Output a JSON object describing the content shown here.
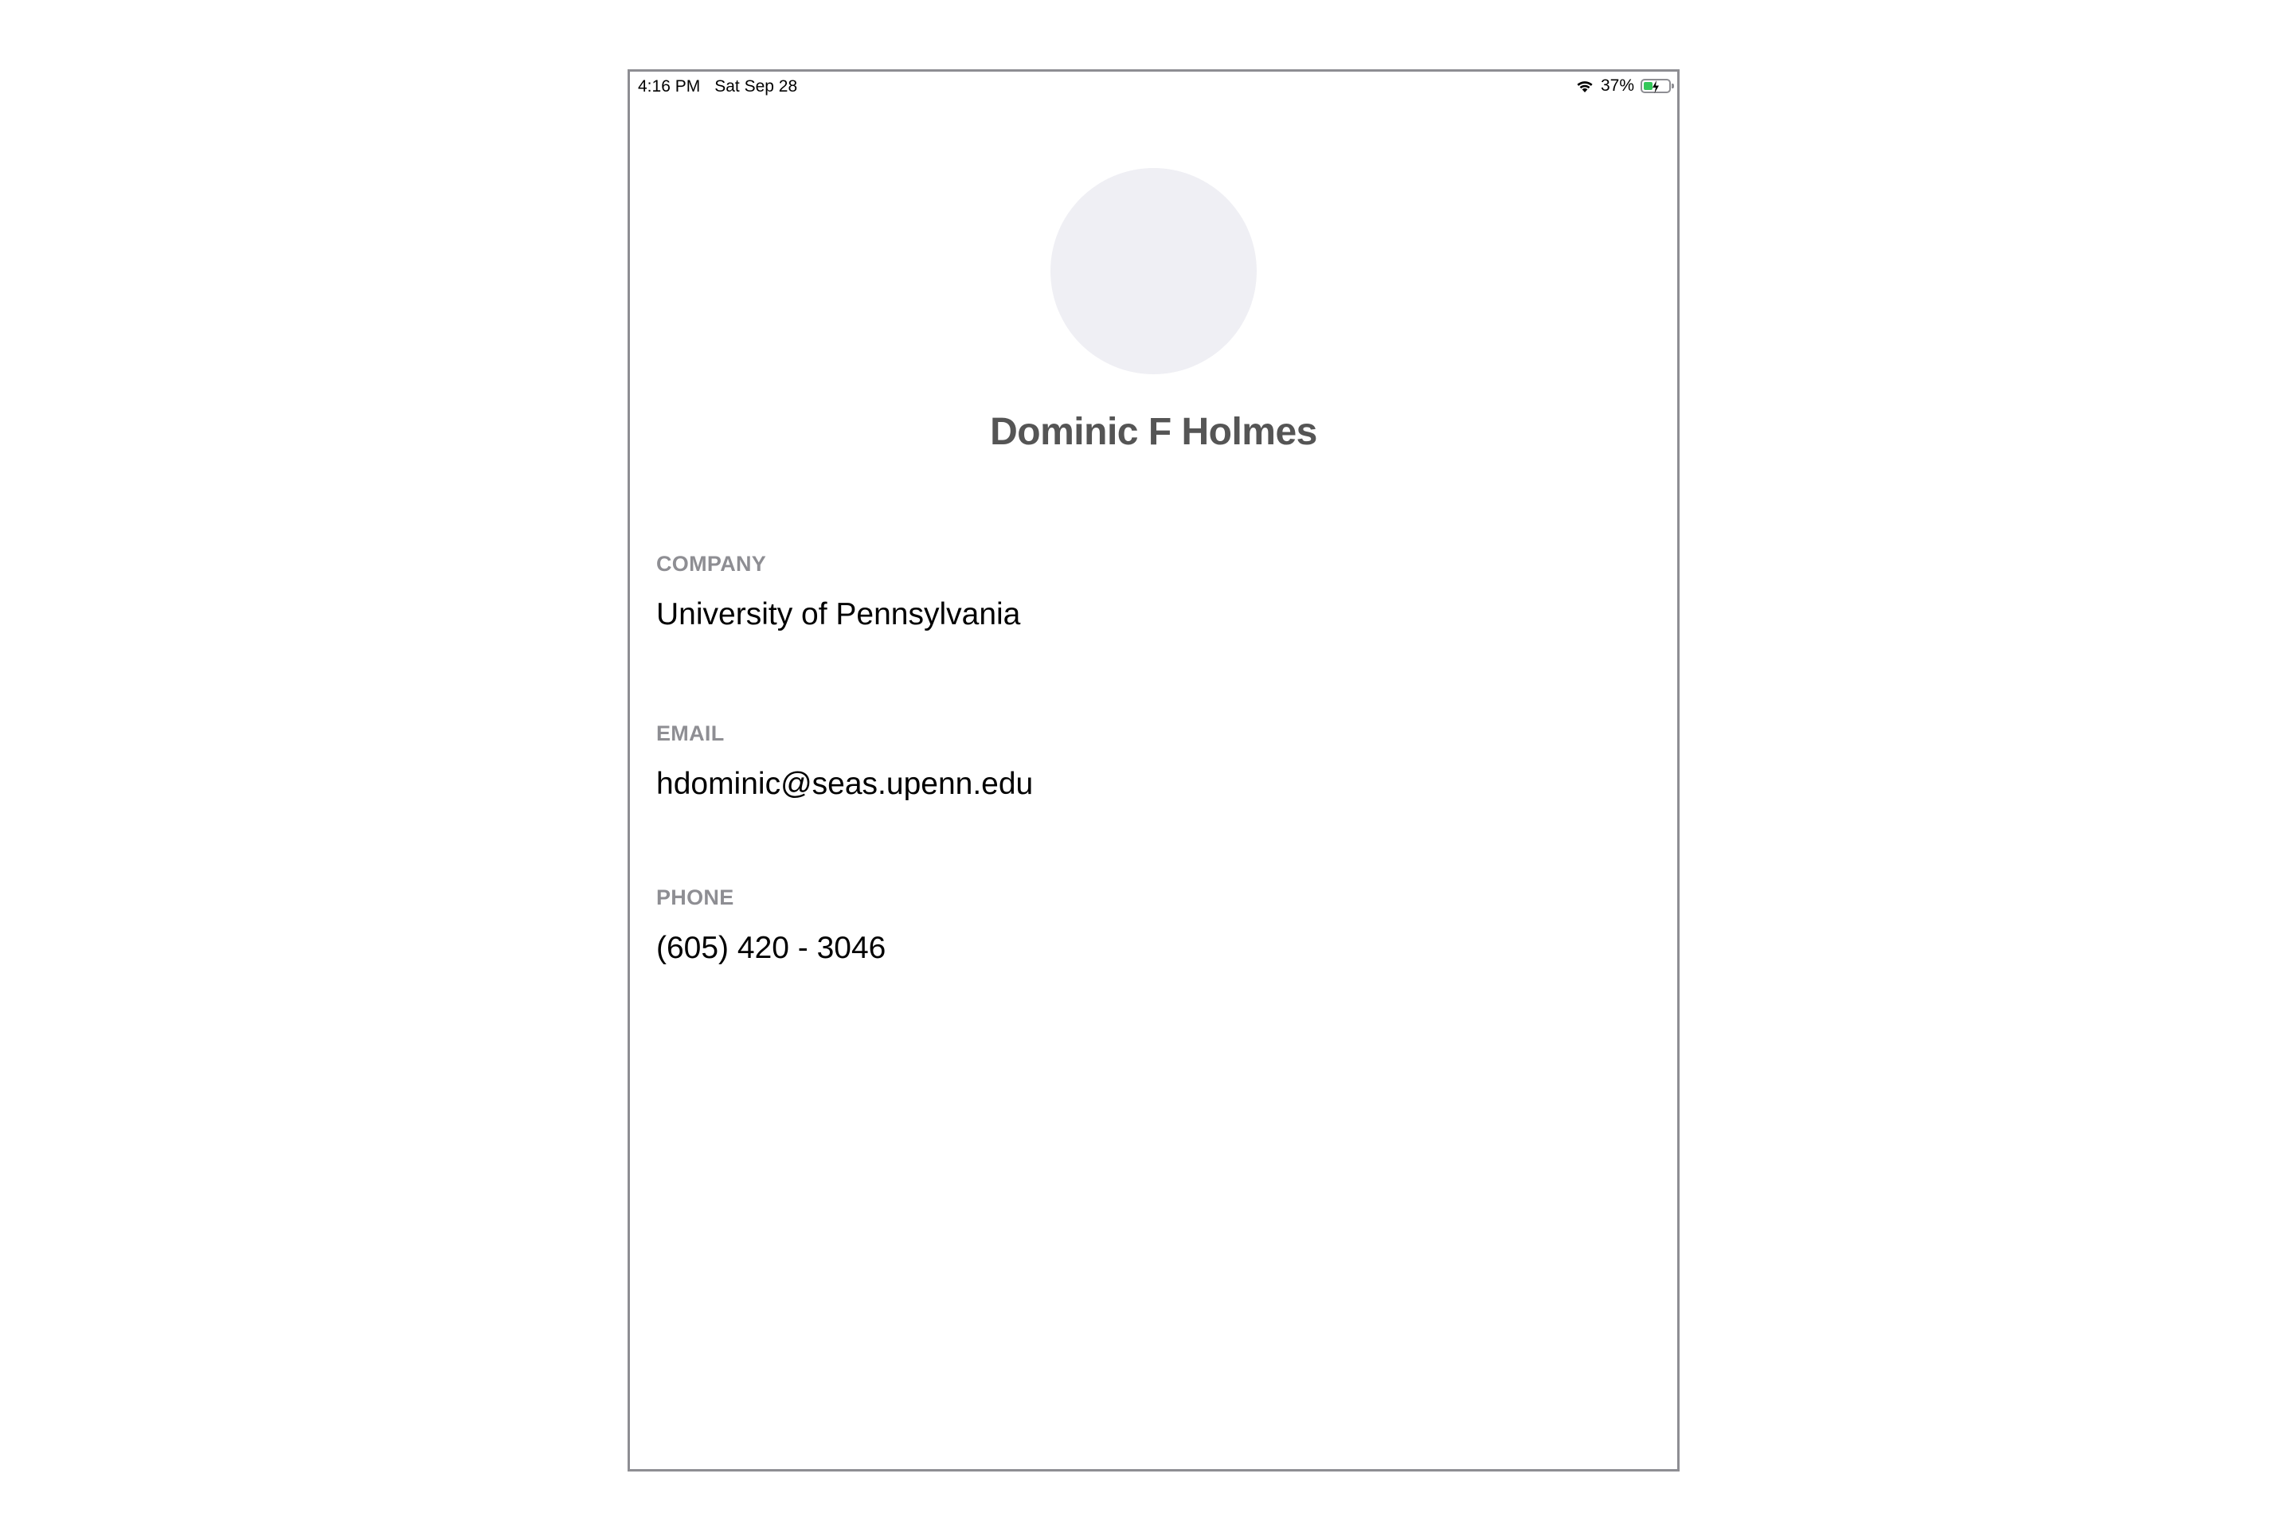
{
  "status_bar": {
    "time": "4:16 PM",
    "date": "Sat Sep 28",
    "battery_percent": "37%",
    "battery_level": 0.37,
    "battery_color": "#34c759",
    "wifi_icon": "wifi-icon",
    "battery_icon": "battery-charging-icon"
  },
  "profile": {
    "avatar_color": "#efeff4",
    "name": "Dominic F Holmes"
  },
  "fields": {
    "company": {
      "label": "COMPANY",
      "value": "University of Pennsylvania"
    },
    "email": {
      "label": "EMAIL",
      "value": "hdominic@seas.upenn.edu"
    },
    "phone": {
      "label": "PHONE",
      "value": "(605) 420 - 3046"
    }
  }
}
